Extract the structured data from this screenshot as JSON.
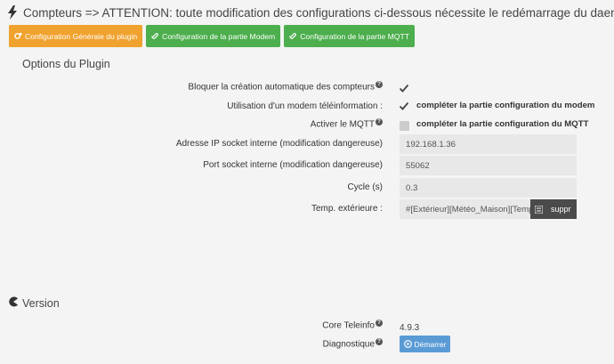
{
  "header": {
    "title": "Compteurs => ATTENTION: toute modification des configurations ci-dessous nécessite le redémarrage du daemon",
    "icon": "bolt-icon"
  },
  "tabs": [
    {
      "label": "Configuration Générale du plugin",
      "icon": "cogs-icon",
      "color": "#f0a22e"
    },
    {
      "label": "Configuration de la partie Modem",
      "icon": "paperclip-icon",
      "color": "#4cae4c"
    },
    {
      "label": "Configuration de la partie MQTT",
      "icon": "paperclip-icon",
      "color": "#4cae4c"
    }
  ],
  "options": {
    "title": "Options du Plugin",
    "block_creation": {
      "label": "Bloquer la création automatique des compteurs",
      "checked": true
    },
    "modem": {
      "label": "Utilisation d'un modem téléinformation :",
      "checked": true,
      "hint": "compléter la partie configuration du modem"
    },
    "mqtt": {
      "label": "Activer le MQTT",
      "checked": false,
      "hint": "compléter la partie configuration du MQTT"
    },
    "ip": {
      "label": "Adresse IP socket interne (modification dangereuse)",
      "value": "192.168.1.36"
    },
    "port": {
      "label": "Port socket interne (modification dangereuse)",
      "value": "55062"
    },
    "cycle": {
      "label": "Cycle (s)",
      "value": "0.3"
    },
    "temp": {
      "label": "Temp. extérieure :",
      "value": "#[Extérieur][Météo_Maison][Température]#",
      "delete_label": "suppr"
    }
  },
  "version": {
    "title": "Version",
    "core_label": "Core Teleinfo",
    "core_value": "4.9.3",
    "diag_label": "Diagnostique",
    "start_label": "Démarrer"
  }
}
